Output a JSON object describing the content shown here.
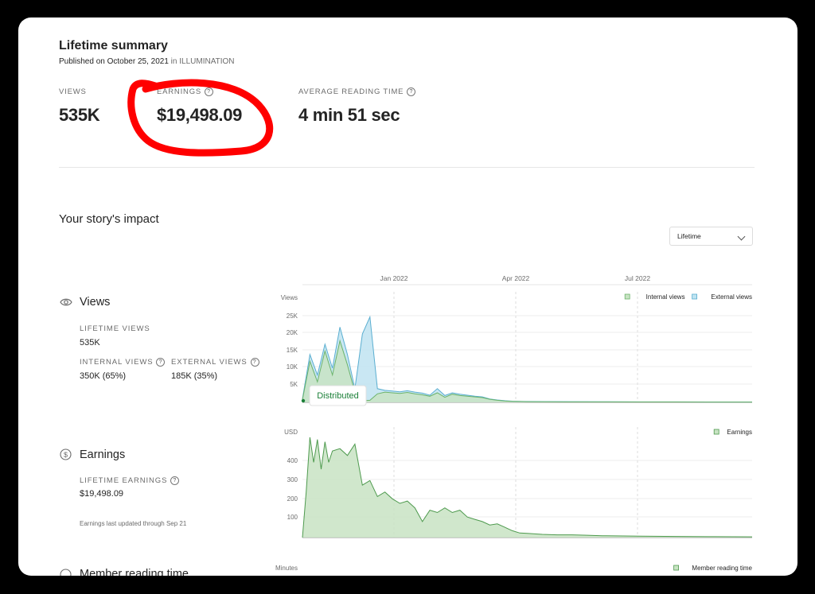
{
  "summary": {
    "title": "Lifetime summary",
    "published_prefix": "Published on October 25, 2021",
    "published_in": "in",
    "publication": "ILLUMINATION",
    "stats": [
      {
        "label": "VIEWS",
        "value": "535K"
      },
      {
        "label": "EARNINGS",
        "value": "$19,498.09"
      },
      {
        "label": "AVERAGE READING TIME",
        "value": "4 min 51 sec"
      }
    ],
    "highlight_color": "#ff0000"
  },
  "impact": {
    "title": "Your story's impact",
    "range_select": "Lifetime"
  },
  "views_section": {
    "title": "Views",
    "lifetime_label": "LIFETIME VIEWS",
    "lifetime_value": "535K",
    "internal_label": "INTERNAL VIEWS",
    "internal_value": "350K (65%)",
    "external_label": "EXTERNAL VIEWS",
    "external_value": "185K (35%)"
  },
  "earnings_section": {
    "title": "Earnings",
    "lifetime_label": "LIFETIME EARNINGS",
    "lifetime_value": "$19,498.09",
    "note": "Earnings last updated through Sep 21"
  },
  "reading_section": {
    "title": "Member reading time"
  },
  "chart_data": [
    {
      "type": "area",
      "x_tick_labels": [
        "Jan 2022",
        "Apr 2022",
        "Jul 2022"
      ],
      "ylabel": "Views",
      "yticks": [
        "25K",
        "20K",
        "15K",
        "10K",
        "5K"
      ],
      "ylim": [
        0,
        30000
      ],
      "legend_placement": "top-right",
      "annotation": "Distributed",
      "x_index_range": [
        0,
        60
      ],
      "series": [
        {
          "name": "Internal views",
          "color": "#6bb36a",
          "fill": "#c8e3c3",
          "x": [
            0,
            1,
            2,
            3,
            4,
            5,
            6,
            7,
            8,
            9,
            10,
            11,
            12,
            13,
            14,
            15,
            16,
            17,
            18,
            19,
            20,
            21,
            22,
            23,
            24,
            25,
            26,
            27,
            28,
            29,
            30,
            35,
            40,
            45,
            50,
            55,
            60
          ],
          "values": [
            800,
            12000,
            6000,
            15000,
            8000,
            18000,
            11000,
            3000,
            500,
            600,
            2500,
            3000,
            2800,
            2600,
            2900,
            2500,
            2200,
            1800,
            2800,
            1500,
            2400,
            2000,
            1800,
            1600,
            1400,
            900,
            600,
            400,
            300,
            250,
            200,
            150,
            150,
            120,
            120,
            100,
            100
          ]
        },
        {
          "name": "External views",
          "color": "#5aaed0",
          "fill": "#bfe3f1",
          "x": [
            0,
            1,
            2,
            3,
            4,
            5,
            6,
            7,
            8,
            9,
            10,
            11,
            12,
            13,
            14,
            15,
            16,
            17,
            18,
            19,
            20,
            21,
            22,
            23,
            24,
            25,
            26,
            27,
            28,
            29,
            30,
            35,
            40,
            45,
            50,
            55,
            60
          ],
          "values": [
            1000,
            14000,
            8000,
            17000,
            10000,
            22000,
            14000,
            4000,
            20000,
            25000,
            4000,
            3500,
            3300,
            3100,
            3400,
            3000,
            2700,
            2100,
            4000,
            2000,
            2800,
            2400,
            2100,
            1800,
            1600,
            1000,
            700,
            500,
            350,
            300,
            250,
            200,
            180,
            150,
            140,
            120,
            110
          ]
        }
      ]
    },
    {
      "type": "area",
      "x_tick_labels": [
        "Jan 2022",
        "Apr 2022",
        "Jul 2022"
      ],
      "ylabel": "USD",
      "yticks": [
        "400",
        "300",
        "200",
        "100"
      ],
      "ylim": [
        0,
        450
      ],
      "legend_placement": "top-right",
      "x_index_range": [
        0,
        60
      ],
      "series": [
        {
          "name": "Earnings",
          "color": "#4e9a4e",
          "fill": "#c8e3c3",
          "x": [
            0,
            0.5,
            1,
            1.5,
            2,
            2.5,
            3,
            3.5,
            4,
            5,
            6,
            7,
            8,
            9,
            10,
            11,
            12,
            13,
            14,
            15,
            16,
            17,
            18,
            19,
            20,
            21,
            22,
            23,
            24,
            25,
            26,
            27,
            28,
            29,
            30,
            32,
            34,
            36,
            38,
            40,
            45,
            50,
            55,
            60
          ],
          "values": [
            0,
            200,
            440,
            330,
            430,
            300,
            420,
            330,
            380,
            390,
            360,
            410,
            230,
            250,
            180,
            200,
            170,
            150,
            160,
            130,
            70,
            120,
            110,
            130,
            110,
            120,
            90,
            80,
            70,
            55,
            60,
            45,
            30,
            20,
            18,
            14,
            12,
            12,
            10,
            8,
            6,
            5,
            4,
            3
          ]
        }
      ]
    },
    {
      "type": "area",
      "ylabel": "Minutes",
      "legend_placement": "top-right",
      "series": [
        {
          "name": "Member reading time",
          "color": "#4e9a4e",
          "fill": "#c8e3c3"
        }
      ]
    }
  ]
}
